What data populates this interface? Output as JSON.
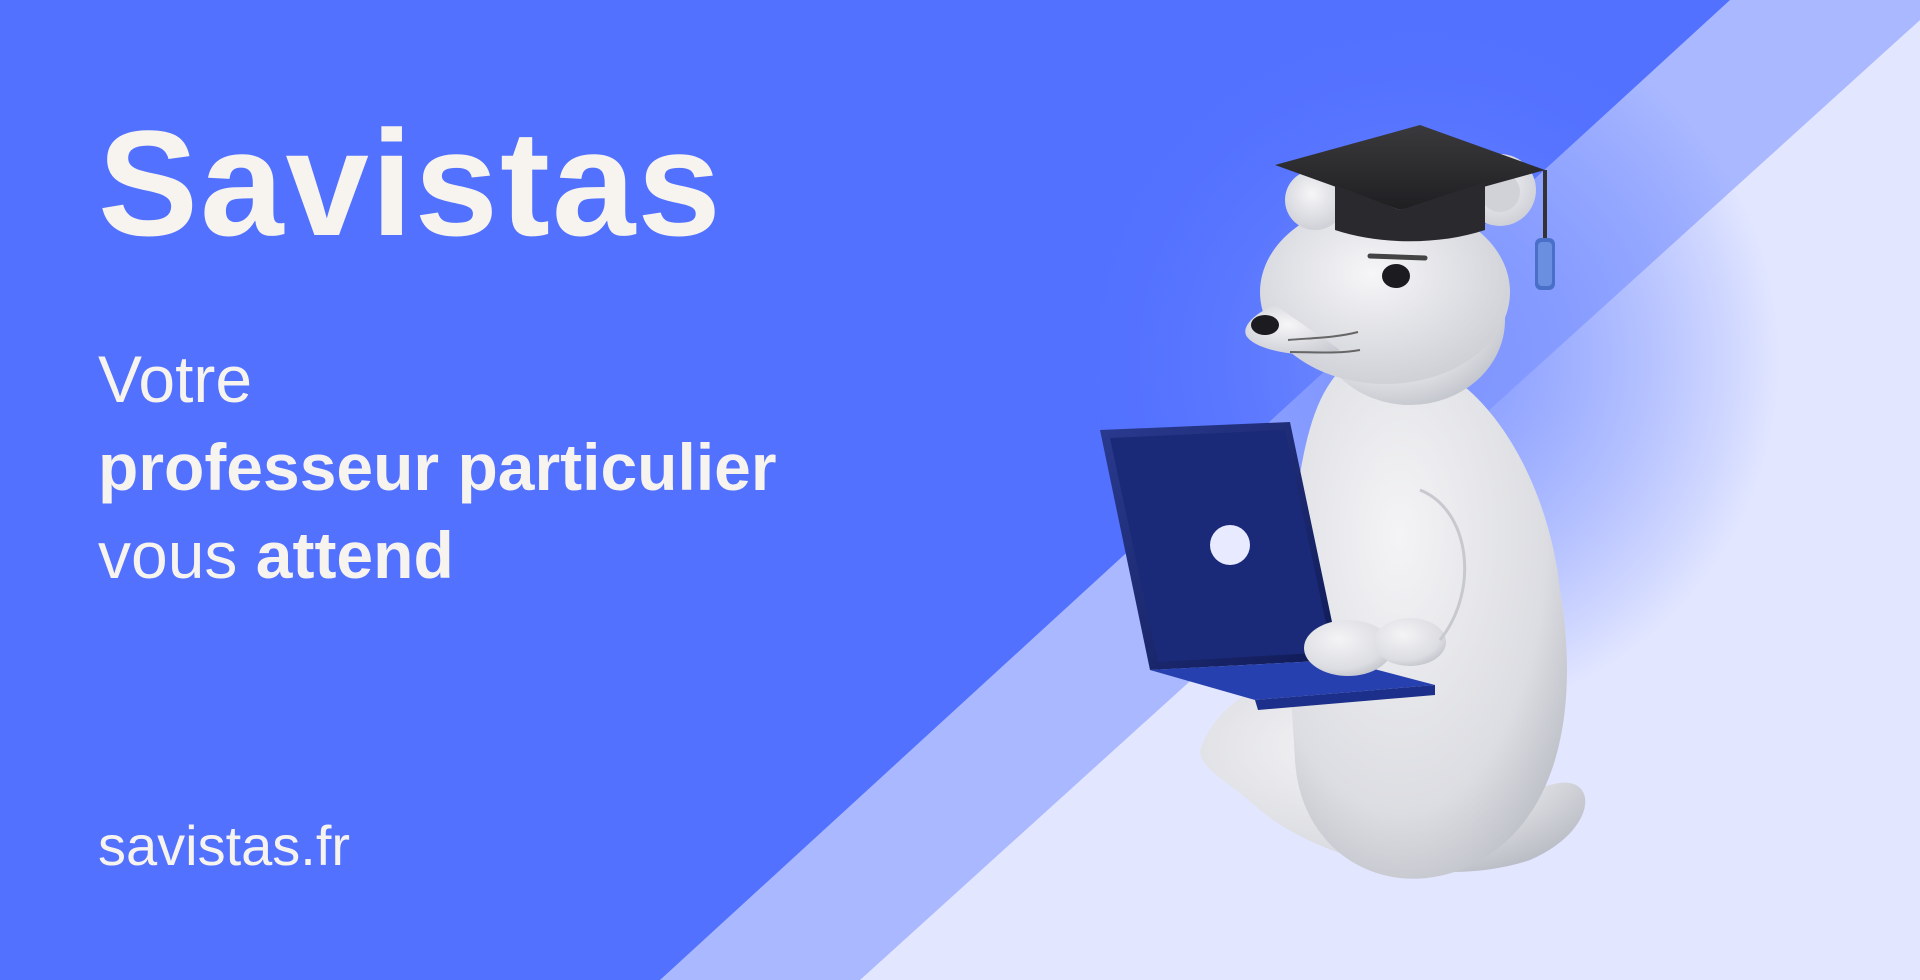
{
  "brand": {
    "name": "Savistas"
  },
  "tagline": {
    "line1": "Votre",
    "line2": "professeur particulier",
    "line3_light": "vous",
    "line3_strong": "attend"
  },
  "footer": {
    "url": "savistas.fr"
  },
  "colors": {
    "background": "#5271ff",
    "accent_light": "#a9b8ff",
    "accent_lighter": "#e2e6ff",
    "text": "#f7f3ef"
  },
  "mascot": {
    "icon": "ermine-graduate-with-laptop-icon"
  }
}
